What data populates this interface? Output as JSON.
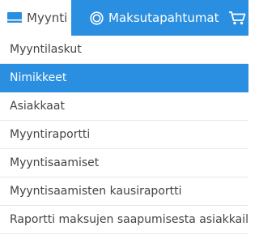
{
  "colors": {
    "accent": "#2a8fe0",
    "text": "#444444",
    "active_text": "#ffffff"
  },
  "tabs": [
    {
      "label": "Myynti",
      "icon": "monitor-icon",
      "active": true
    },
    {
      "label": "Maksutapahtumat",
      "icon": "coin-icon",
      "active": false
    },
    {
      "label": "",
      "icon": "cart-icon",
      "active": false
    }
  ],
  "menu": {
    "items": [
      {
        "label": "Myyntilaskut",
        "active": false
      },
      {
        "label": "Nimikkeet",
        "active": true
      },
      {
        "label": "Asiakkaat",
        "active": false
      },
      {
        "label": "Myyntiraportti",
        "active": false
      },
      {
        "label": "Myyntisaamiset",
        "active": false
      },
      {
        "label": "Myyntisaamisten kausiraportti",
        "active": false
      },
      {
        "label": "Raportti maksujen saapumisesta asiakkailta",
        "active": false
      }
    ]
  }
}
